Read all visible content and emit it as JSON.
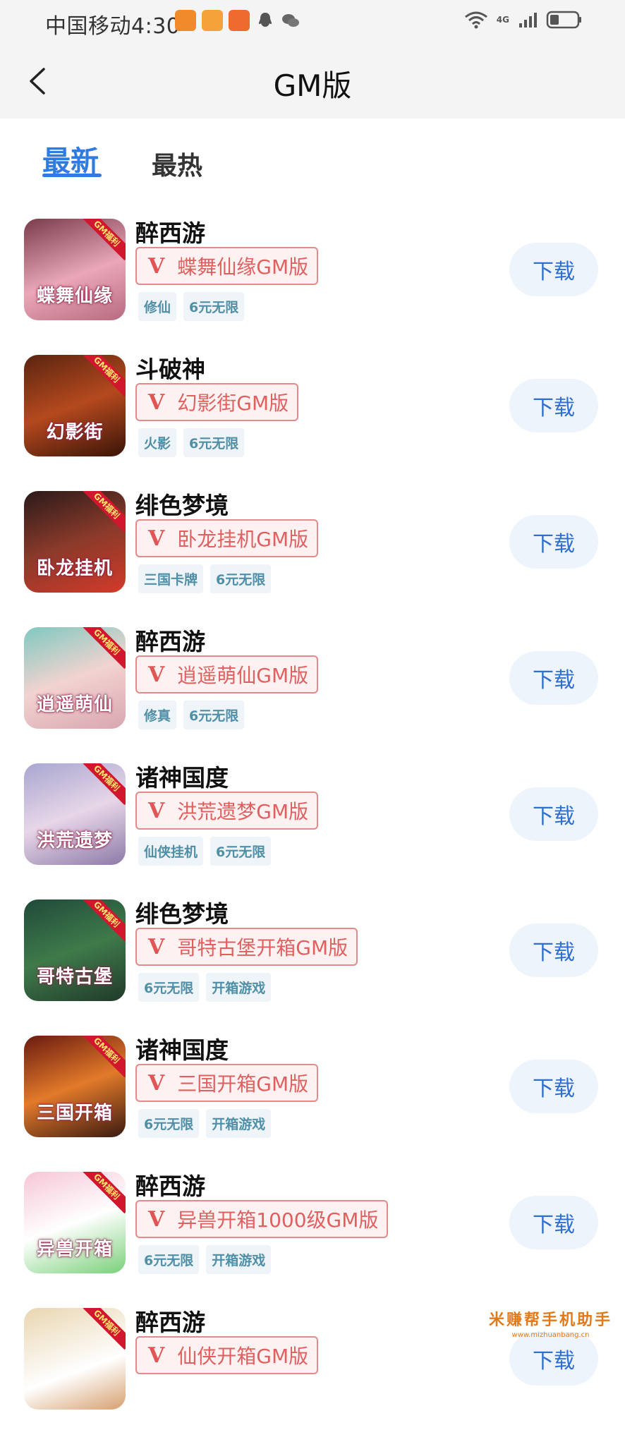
{
  "status_bar": {
    "carrier": "中国移动",
    "time": "4:30",
    "network": "4G"
  },
  "nav": {
    "title": "GM版"
  },
  "tabs": [
    {
      "label": "最新",
      "active": true
    },
    {
      "label": "最热",
      "active": false
    }
  ],
  "items": [
    {
      "name": "醉西游",
      "tag": "蝶舞仙缘GM版",
      "chips": [
        "修仙",
        "6元无限"
      ],
      "thumb_text": "蝶舞仙缘",
      "download_label": "下载"
    },
    {
      "name": "斗破神",
      "tag": "幻影街GM版",
      "chips": [
        "火影",
        "6元无限"
      ],
      "thumb_text": "幻影街",
      "download_label": "下载"
    },
    {
      "name": "绯色梦境",
      "tag": "卧龙挂机GM版",
      "chips": [
        "三国卡牌",
        "6元无限"
      ],
      "thumb_text": "卧龙挂机",
      "download_label": "下载"
    },
    {
      "name": "醉西游",
      "tag": "逍遥萌仙GM版",
      "chips": [
        "修真",
        "6元无限"
      ],
      "thumb_text": "逍遥萌仙",
      "download_label": "下载"
    },
    {
      "name": "诸神国度",
      "tag": "洪荒遗梦GM版",
      "chips": [
        "仙侠挂机",
        "6元无限"
      ],
      "thumb_text": "洪荒遗梦",
      "download_label": "下载"
    },
    {
      "name": "绯色梦境",
      "tag": "哥特古堡开箱GM版",
      "chips": [
        "6元无限",
        "开箱游戏"
      ],
      "thumb_text": "哥特古堡",
      "download_label": "下载"
    },
    {
      "name": "诸神国度",
      "tag": "三国开箱GM版",
      "chips": [
        "6元无限",
        "开箱游戏"
      ],
      "thumb_text": "三国开箱",
      "download_label": "下载"
    },
    {
      "name": "醉西游",
      "tag": "异兽开箱1000级GM版",
      "chips": [
        "6元无限",
        "开箱游戏"
      ],
      "thumb_text": "异兽开箱",
      "download_label": "下载"
    },
    {
      "name": "醉西游",
      "tag": "仙侠开箱GM版",
      "chips": [],
      "thumb_text": "",
      "download_label": "下载"
    }
  ],
  "thumb_corner_label": "GM福利",
  "watermark": {
    "title": "米赚帮手机助手",
    "url": "www.mizhuanbang.cn"
  },
  "colors": {
    "accent": "#2f7be0",
    "tag_red": "#e05656",
    "chip_text": "#4f8fa8",
    "download_text": "#2f6fd0"
  }
}
